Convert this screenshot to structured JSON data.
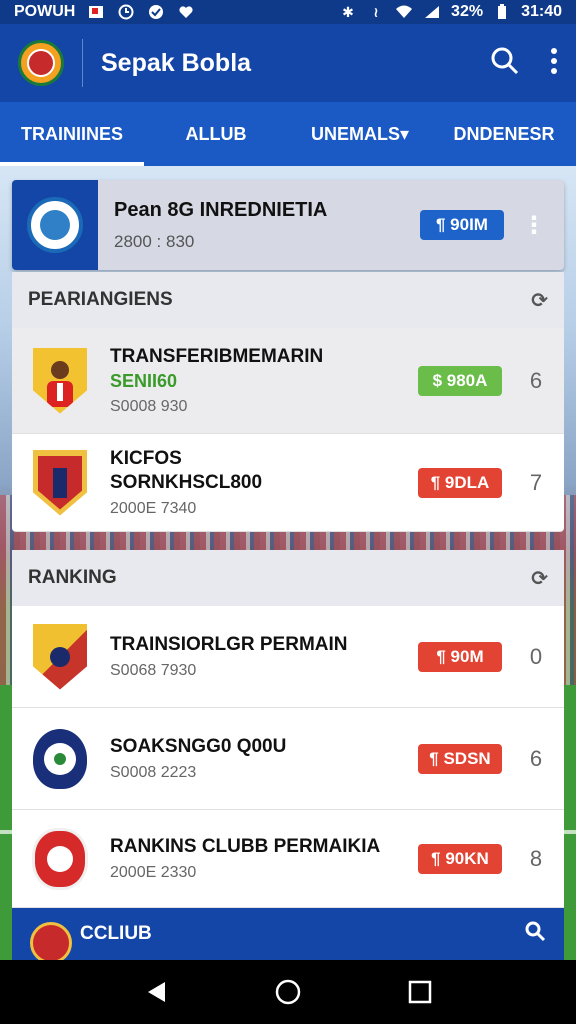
{
  "status_bar": {
    "carrier": "POWUH",
    "battery": "32%",
    "time": "31:40"
  },
  "app": {
    "title": "Sepak Bobla"
  },
  "tabs": [
    {
      "label": "TRAINIINES",
      "active": true
    },
    {
      "label": "ALLUB",
      "active": false
    },
    {
      "label": "UNEMALS▾",
      "active": false
    },
    {
      "label": "DNDENESR",
      "active": false
    }
  ],
  "featured": {
    "title": "Pean 8G INREDNIETIA",
    "subtitle": "2800 : 830",
    "pill": "¶ 90IM"
  },
  "section1": {
    "title": "PEARIANGIENS"
  },
  "rows1": [
    {
      "title": "TRANSFERIBMEMARIN",
      "green": "SENII60",
      "sub": "S0008 930",
      "pill": "$ 980A",
      "rank": "6"
    },
    {
      "title": "KICFOS\nSORNKHSCL800",
      "sub": "2000E 7340",
      "pill": "¶ 9DLA",
      "rank": "7"
    }
  ],
  "section2": {
    "title": "RANKING"
  },
  "rows2": [
    {
      "title": "TRAINSIORLGR PERMAIN",
      "sub": "S0068 7930",
      "pill": "¶ 90M",
      "rank": "0"
    },
    {
      "title": "SOAKSNGG0 Q00U",
      "sub": "S0008 2223",
      "pill": "¶ SDSN",
      "rank": "6"
    },
    {
      "title": "RANKINS CLUBB PERMAIKIA",
      "sub": "2000E 2330",
      "pill": "¶ 90KN",
      "rank": "8"
    }
  ],
  "footer": {
    "title": "CCLIUB"
  },
  "colors": {
    "primary": "#1446a8",
    "tab_bar": "#1b5ac4",
    "green_pill": "#6bbd4a",
    "red_pill": "#e24333",
    "blue_pill": "#1e63c9"
  }
}
